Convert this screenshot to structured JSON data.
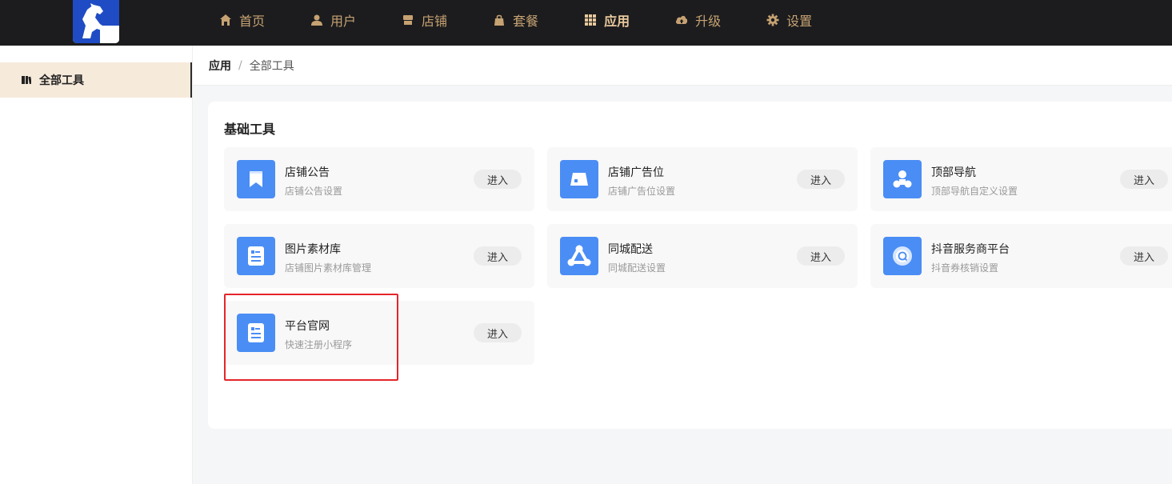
{
  "header": {
    "logo_name": "horse-logo",
    "nav": [
      {
        "label": "首页",
        "icon": "home-icon",
        "active": false
      },
      {
        "label": "用户",
        "icon": "user-icon",
        "active": false
      },
      {
        "label": "店铺",
        "icon": "store-icon",
        "active": false
      },
      {
        "label": "套餐",
        "icon": "bag-icon",
        "active": false
      },
      {
        "label": "应用",
        "icon": "grid-icon",
        "active": true
      },
      {
        "label": "升级",
        "icon": "cloud-upload-icon",
        "active": false
      },
      {
        "label": "设置",
        "icon": "gear-icon",
        "active": false
      }
    ]
  },
  "sidebar": {
    "items": [
      {
        "label": "全部工具",
        "icon": "book-icon",
        "active": true
      }
    ]
  },
  "breadcrumb": {
    "first": "应用",
    "separator": "/",
    "current": "全部工具"
  },
  "section": {
    "title": "基础工具",
    "cards": [
      {
        "name": "店铺公告",
        "desc": "店铺公告设置",
        "button": "进入",
        "icon": "bookmark-icon"
      },
      {
        "name": "店铺广告位",
        "desc": "店铺广告位设置",
        "button": "进入",
        "icon": "ad-board-icon"
      },
      {
        "name": "顶部导航",
        "desc": "顶部导航自定义设置",
        "button": "进入",
        "icon": "navigation-icon"
      },
      {
        "name": "图片素材库",
        "desc": "店铺图片素材库管理",
        "button": "进入",
        "icon": "image-doc-icon"
      },
      {
        "name": "同城配送",
        "desc": "同城配送设置",
        "button": "进入",
        "icon": "delivery-network-icon"
      },
      {
        "name": "抖音服务商平台",
        "desc": "抖音券核销设置",
        "button": "进入",
        "icon": "douyin-service-icon"
      },
      {
        "name": "平台官网",
        "desc": "快速注册小程序",
        "button": "进入",
        "icon": "website-doc-icon"
      }
    ]
  },
  "colors": {
    "topbar": "#1c1c1e",
    "nav_text": "#c6a272",
    "accent_icon": "#4a8df5",
    "highlight": "#e5252a",
    "sidebar_active": "#f6eadb"
  }
}
